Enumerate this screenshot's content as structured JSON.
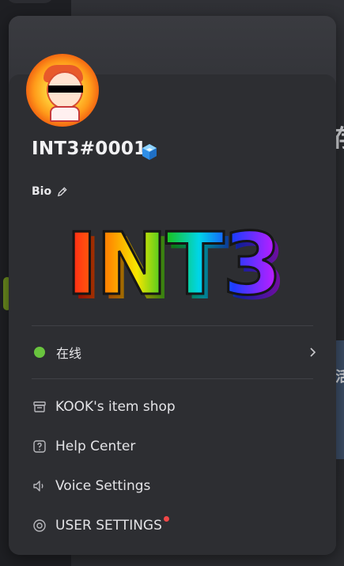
{
  "profile": {
    "username": "INT3#0001",
    "bio_label": "Bio",
    "bio_art_text": "INT3",
    "avatar_icon": "avatar-image"
  },
  "status": {
    "label": "在线",
    "color": "#69c43e"
  },
  "menu": {
    "items": [
      {
        "label": "KOOK's item shop",
        "icon": "shop-icon"
      },
      {
        "label": "Help Center",
        "icon": "help-icon"
      },
      {
        "label": "Voice Settings",
        "icon": "speaker-icon"
      },
      {
        "label": "USER SETTINGS",
        "icon": "settings-icon",
        "has_notification": true
      }
    ]
  },
  "colors": {
    "panel_bg": "#2d2e32",
    "notification": "#f04747",
    "gem": "#3aa8ff"
  },
  "background": {
    "glyphs": [
      "存",
      "活"
    ]
  }
}
